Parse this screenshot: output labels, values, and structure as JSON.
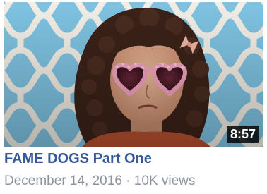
{
  "video": {
    "title": "FAME DOGS Part One",
    "duration": "8:57",
    "date": "December 14, 2016",
    "separator": "·",
    "views": "10K views",
    "thumbnail_icon": "video-thumbnail-icon"
  },
  "colors": {
    "title": "#365899",
    "meta": "#8d949e",
    "wallpaper": "#7fc3e2",
    "lattice": "#f3efe6",
    "hair": "#3b2218",
    "glasses": "#f3a3c0"
  }
}
